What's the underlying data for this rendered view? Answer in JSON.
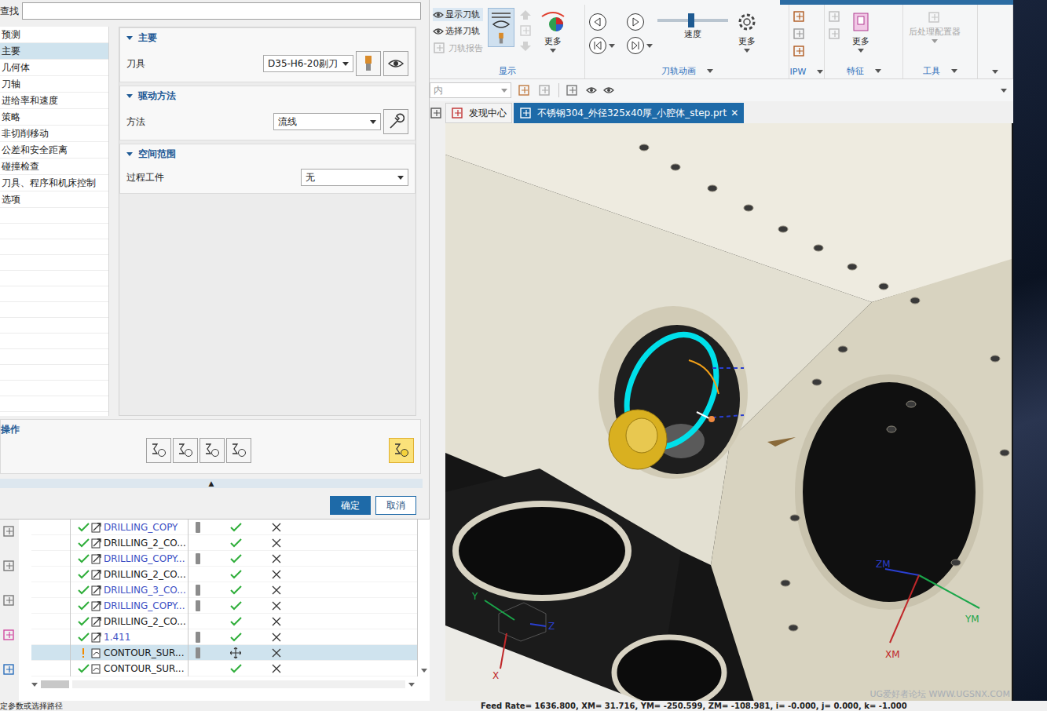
{
  "dialog": {
    "search": {
      "label": "查找",
      "value": ""
    },
    "nav": [
      {
        "label": "预测",
        "selected": false
      },
      {
        "label": "主要",
        "selected": true
      },
      {
        "label": "几何体",
        "selected": false
      },
      {
        "label": "刀轴",
        "selected": false
      },
      {
        "label": "进给率和速度",
        "selected": false
      },
      {
        "label": "策略",
        "selected": false
      },
      {
        "label": "非切削移动",
        "selected": false
      },
      {
        "label": "公差和安全距离",
        "selected": false
      },
      {
        "label": "碰撞检查",
        "selected": false
      },
      {
        "label": "刀具、程序和机床控制",
        "selected": false
      },
      {
        "label": "选项",
        "selected": false
      }
    ],
    "sections": [
      {
        "title": "主要",
        "expanded": true,
        "field": {
          "label": "刀具",
          "value": "D35-H6-20剔刀",
          "kind": "tool"
        }
      },
      {
        "title": "驱动方法",
        "expanded": true,
        "field": {
          "label": "方法",
          "value": "流线",
          "kind": "method"
        }
      },
      {
        "title": "空间范围",
        "expanded": true,
        "field": {
          "label": "过程工件",
          "value": "无",
          "kind": "plain"
        }
      }
    ],
    "operations": {
      "title": "操作",
      "buttons": [
        {
          "selected": false
        },
        {
          "selected": false
        },
        {
          "selected": false
        },
        {
          "selected": false
        },
        {
          "selected": true
        }
      ]
    },
    "collapse": "▲",
    "buttons": [
      {
        "label": "确定",
        "primary": true
      },
      {
        "label": "取消",
        "primary": false
      }
    ]
  },
  "navigator": {
    "rows": [
      {
        "name": "DRILLING_COPY",
        "color": "#3d50c4",
        "kind": "drill",
        "tool": true,
        "warning": false,
        "status": "ok",
        "selected": false
      },
      {
        "name": "DRILLING_2_CO...",
        "color": "#1a1a1a",
        "kind": "drill",
        "tool": false,
        "warning": false,
        "status": "ok",
        "selected": false
      },
      {
        "name": "DRILLING_COPY...",
        "color": "#3d50c4",
        "kind": "drill",
        "tool": true,
        "warning": false,
        "status": "ok",
        "selected": false
      },
      {
        "name": "DRILLING_2_CO...",
        "color": "#1a1a1a",
        "kind": "drill",
        "tool": false,
        "warning": false,
        "status": "ok",
        "selected": false
      },
      {
        "name": "DRILLING_3_CO...",
        "color": "#3d50c4",
        "kind": "drill",
        "tool": true,
        "warning": false,
        "status": "ok",
        "selected": false
      },
      {
        "name": "DRILLING_COPY...",
        "color": "#3d50c4",
        "kind": "drill",
        "tool": true,
        "warning": false,
        "status": "ok",
        "selected": false
      },
      {
        "name": "DRILLING_2_CO...",
        "color": "#1a1a1a",
        "kind": "drill",
        "tool": false,
        "warning": false,
        "status": "ok",
        "selected": false
      },
      {
        "name": "1.411",
        "color": "#3d50c4",
        "kind": "drill",
        "tool": true,
        "warning": false,
        "status": "ok",
        "selected": false
      },
      {
        "name": "CONTOUR_SUR...",
        "color": "#1a1a1a",
        "kind": "contour",
        "tool": true,
        "warning": true,
        "status": "moved",
        "selected": true
      },
      {
        "name": "CONTOUR_SUR...",
        "color": "#1a1a1a",
        "kind": "contour",
        "tool": false,
        "warning": false,
        "status": "ok",
        "selected": false
      }
    ]
  },
  "ribbon": {
    "display": {
      "label": "显示",
      "has_menu": false,
      "items": [
        {
          "label": "显示刀轨",
          "selected": true,
          "disabled": false
        },
        {
          "label": "选择刀轨",
          "selected": false,
          "disabled": false
        },
        {
          "label": "刀轨报告",
          "selected": false,
          "disabled": true
        }
      ],
      "toggle_selected": true,
      "more": "更多"
    },
    "animation": {
      "label": "刀轨动画",
      "has_menu": true,
      "speed": {
        "label": "速度",
        "level": 0.48
      },
      "more": "更多"
    },
    "ipw": {
      "label": "IPW",
      "has_menu": true
    },
    "features": {
      "label": "特征",
      "has_menu": true,
      "more": "更多"
    },
    "tools": {
      "label": "工具",
      "has_menu": true,
      "postprocessor": {
        "label": "后处理配置器",
        "disabled": true
      }
    }
  },
  "toolbar": {
    "filter": "内"
  },
  "tabs": [
    {
      "label": "发现中心",
      "selected": false,
      "close": ""
    },
    {
      "label": "不锈钢304_外径325x40厚_小腔体_step.prt",
      "selected": true,
      "close": "✕"
    }
  ],
  "viewport": {
    "axes": [
      {
        "label": "ZM",
        "color": "#2a3fd0"
      },
      {
        "label": "YM",
        "color": "#1aa64a"
      },
      {
        "label": "XM",
        "color": "#c0282a"
      },
      {
        "label": "Y",
        "color": "#1aa64a"
      },
      {
        "label": "Z",
        "color": "#2a3fd0"
      },
      {
        "label": "X",
        "color": "#c0282a"
      }
    ],
    "watermark": "UG爱好者论坛 WWW.UGSNX.COM"
  },
  "status_bar": {
    "prompt": "定参数或选择路径",
    "readout": "Feed Rate= 1636.800, XM= 31.716, YM= -250.599, ZM= -108.981, i= -0.000, j= 0.000, k= -1.000"
  }
}
